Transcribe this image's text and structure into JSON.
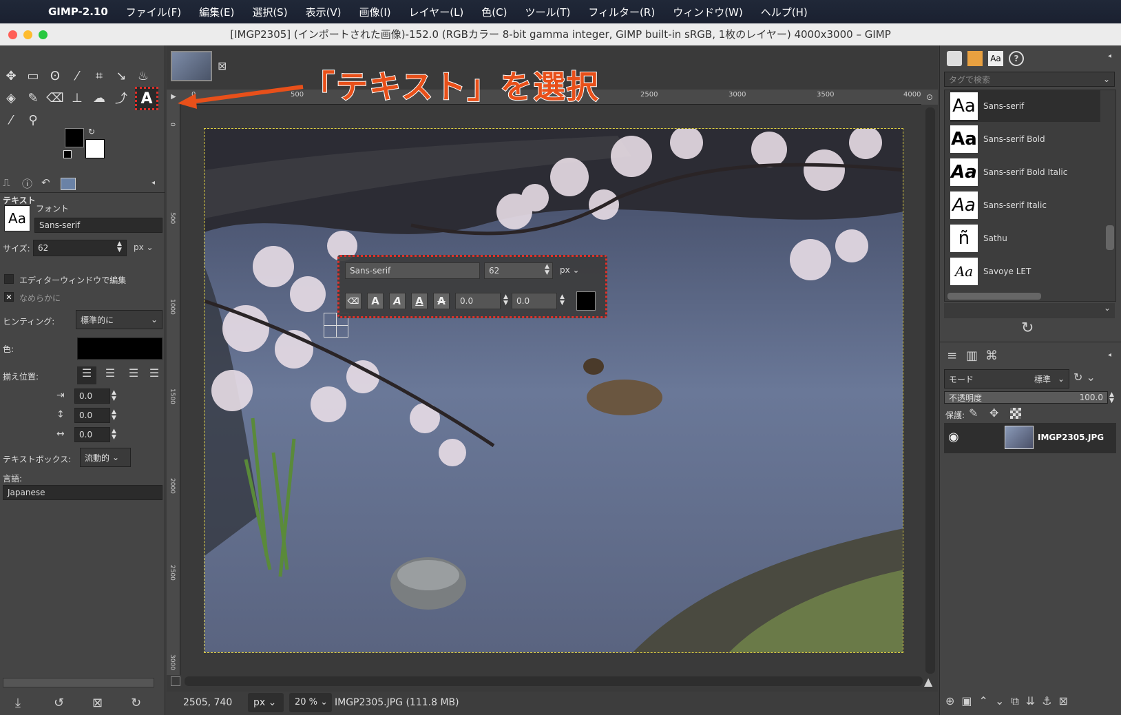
{
  "menubar": {
    "app": "GIMP-2.10",
    "items": [
      "ファイル(F)",
      "編集(E)",
      "選択(S)",
      "表示(V)",
      "画像(I)",
      "レイヤー(L)",
      "色(C)",
      "ツール(T)",
      "フィルター(R)",
      "ウィンドウ(W)",
      "ヘルプ(H)"
    ]
  },
  "window": {
    "title": "[IMGP2305] (インポートされた画像)-152.0 (RGBカラー 8-bit gamma integer, GIMP built-in sRGB, 1枚のレイヤー) 4000x3000 – GIMP"
  },
  "annotation": {
    "text": "「テキスト」を選択",
    "color": "#e8501a"
  },
  "tool_options": {
    "title": "テキスト",
    "font_label": "フォント",
    "font_value": "Sans-serif",
    "font_preview": "Aa",
    "size_label": "サイズ:",
    "size_value": "62",
    "size_unit": "px",
    "editor_label": "エディターウィンドウで編集",
    "antialias_label": "なめらかに",
    "hinting_label": "ヒンティング:",
    "hinting_value": "標準的に",
    "color_label": "色:",
    "justify_label": "揃え位置:",
    "indent_value": "0.0",
    "line_spacing_value": "0.0",
    "letter_spacing_value": "0.0",
    "box_label": "テキストボックス:",
    "box_value": "流動的",
    "language_label": "言語:",
    "language_value": "Japanese"
  },
  "ruler": {
    "top_ticks": [
      "0",
      "500",
      "2500",
      "3000",
      "3500",
      "4000"
    ],
    "left_ticks": [
      "0",
      "500",
      "1000",
      "1500",
      "2000",
      "2500",
      "3000"
    ]
  },
  "text_overlay": {
    "font": "Sans-serif",
    "size": "62",
    "unit": "px",
    "baseline": "0.0",
    "kerning": "0.0"
  },
  "status": {
    "coords": "2505, 740",
    "unit": "px",
    "zoom": "20 %",
    "file_info": "IMGP2305.JPG (111.8 MB)"
  },
  "fonts_panel": {
    "search_placeholder": "タグで検索",
    "items": [
      {
        "preview": "Aa",
        "name": "Sans-serif"
      },
      {
        "preview": "Aa",
        "name": "Sans-serif Bold"
      },
      {
        "preview": "Aa",
        "name": "Sans-serif Bold Italic"
      },
      {
        "preview": "Aa",
        "name": "Sans-serif Italic"
      },
      {
        "preview": "ñ",
        "name": "Sathu"
      },
      {
        "preview": "Aa",
        "name": "Savoye LET"
      }
    ]
  },
  "layers_panel": {
    "mode_label": "モード",
    "mode_value": "標準",
    "opacity_label": "不透明度",
    "opacity_value": "100.0",
    "lock_label": "保護:",
    "layer_name": "IMGP2305.JPG"
  }
}
